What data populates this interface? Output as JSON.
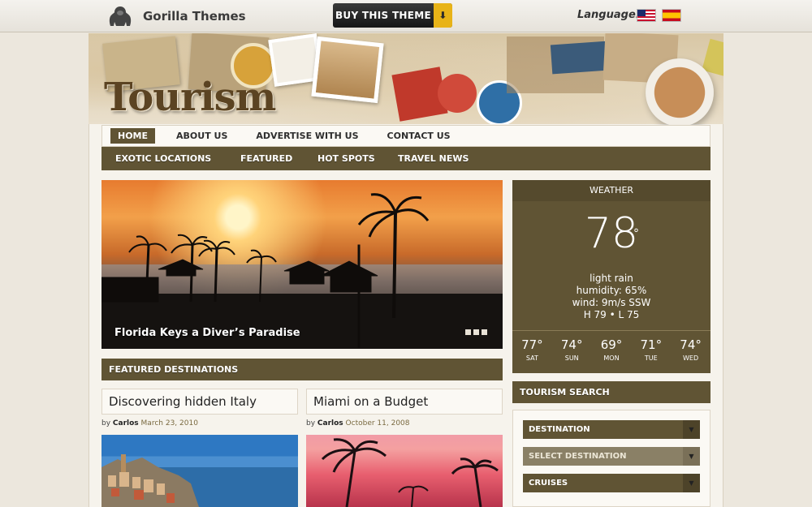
{
  "topbar": {
    "brand": "Gorilla Themes",
    "buy_label": "BUY THIS THEME",
    "language_label": "Language:",
    "flags": [
      "flag-us-icon",
      "flag-es-icon"
    ]
  },
  "header": {
    "site_title": "Tourism"
  },
  "nav_primary": [
    {
      "label": "HOME",
      "active": true
    },
    {
      "label": "ABOUT US"
    },
    {
      "label": "ADVERTISE WITH US"
    },
    {
      "label": "CONTACT US"
    }
  ],
  "nav_secondary": [
    {
      "label": "EXOTIC LOCATIONS"
    },
    {
      "label": "FEATURED"
    },
    {
      "label": "HOT SPOTS"
    },
    {
      "label": "TRAVEL NEWS"
    }
  ],
  "slider": {
    "caption": "Florida Keys a Diver’s Paradise",
    "dots": 3
  },
  "featured": {
    "heading": "FEATURED DESTINATIONS",
    "posts": [
      {
        "title": "Discovering hidden Italy",
        "by": "by",
        "author": "Carlos",
        "date": "March 23, 2010"
      },
      {
        "title": "Miami on a Budget",
        "by": "by",
        "author": "Carlos",
        "date": "October 11, 2008"
      }
    ]
  },
  "weather": {
    "heading": "WEATHER",
    "temp": "78",
    "deg": "°",
    "condition": "light rain",
    "humidity": "humidity: 65%",
    "wind": "wind: 9m/s SSW",
    "hilo": "H 79 • L 75",
    "forecast": [
      {
        "temp": "77°",
        "day": "SAT"
      },
      {
        "temp": "74°",
        "day": "SUN"
      },
      {
        "temp": "69°",
        "day": "MON"
      },
      {
        "temp": "71°",
        "day": "TUE"
      },
      {
        "temp": "74°",
        "day": "WED"
      }
    ]
  },
  "search": {
    "heading": "TOURISM SEARCH",
    "fields": [
      {
        "label": "DESTINATION"
      },
      {
        "label": "SELECT DESTINATION"
      },
      {
        "label": "CRUISES"
      }
    ]
  }
}
